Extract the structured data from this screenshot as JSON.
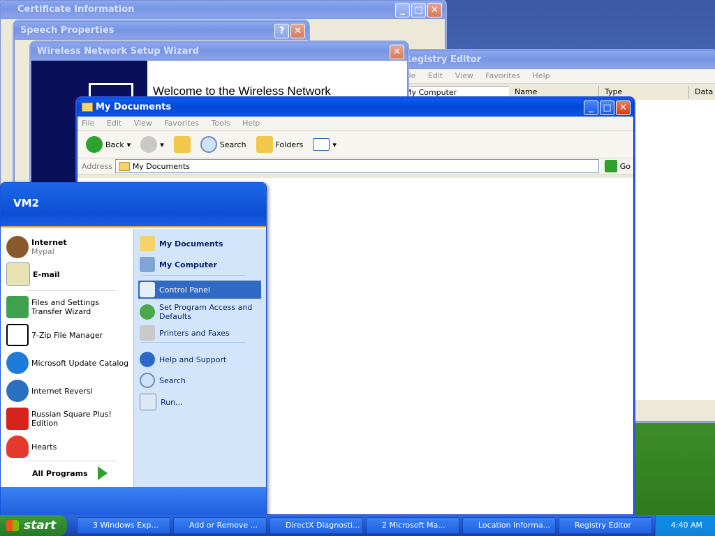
{
  "windows": {
    "certificate": {
      "title": "Certificate Information"
    },
    "speech": {
      "title": "Speech Properties"
    },
    "wireless": {
      "title": "Wireless Network Setup Wizard",
      "heading": "Welcome to the Wireless Network"
    },
    "registry": {
      "title": "Registry Editor",
      "menu": [
        "File",
        "Edit",
        "View",
        "Favorites",
        "Help"
      ],
      "tree_item": "My Computer",
      "columns": [
        "Name",
        "Type",
        "Data"
      ]
    },
    "mydocs": {
      "title": "My Documents",
      "menu": [
        "File",
        "Edit",
        "View",
        "Favorites",
        "Tools",
        "Help"
      ],
      "toolbar": {
        "back": "Back",
        "search": "Search",
        "folders": "Folders"
      },
      "address_label": "Address",
      "address_value": "My Documents",
      "go": "Go"
    }
  },
  "start_menu": {
    "user": "VM2",
    "left_items": [
      {
        "label": "Internet",
        "sub": "Mypal"
      },
      {
        "label": "E-mail"
      },
      {
        "label": "Files and Settings Transfer Wizard"
      },
      {
        "label": "7-Zip File Manager"
      },
      {
        "label": "Microsoft Update Catalog"
      },
      {
        "label": "Internet Reversi"
      },
      {
        "label": "Russian Square Plus! Edition"
      },
      {
        "label": "Hearts"
      }
    ],
    "all_programs": "All Programs",
    "right_items": [
      {
        "label": "My Documents"
      },
      {
        "label": "My Computer"
      },
      {
        "label": "Control Panel"
      },
      {
        "label": "Set Program Access and Defaults"
      },
      {
        "label": "Printers and Faxes"
      },
      {
        "label": "Help and Support"
      },
      {
        "label": "Search"
      },
      {
        "label": "Run..."
      }
    ]
  },
  "taskbar": {
    "start": "start",
    "tasks": [
      "3 Windows Exp...",
      "Add or Remove ...",
      "DirectX Diagnosti...",
      "2 Microsoft Ma...",
      "Location Informa...",
      "Registry Editor"
    ],
    "clock": "4:40 AM"
  },
  "colors": {
    "xp_blue": "#0a5ff5",
    "start_green": "#2f8a2f",
    "selection": "#316ac5"
  }
}
